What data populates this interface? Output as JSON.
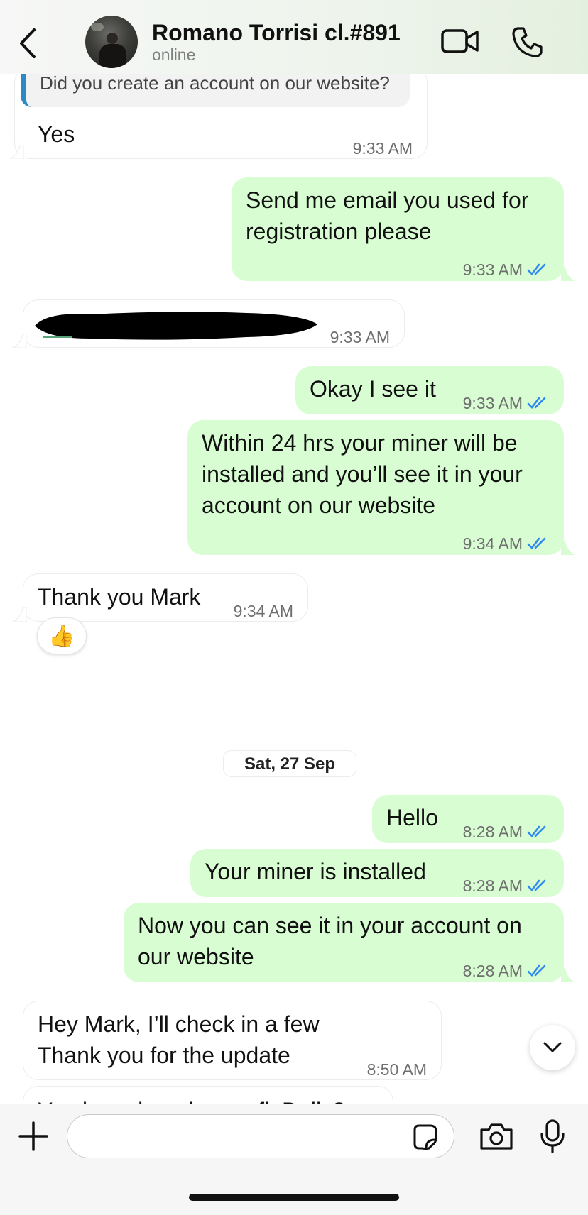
{
  "header": {
    "contact_name": "Romano Torrisi cl.#891",
    "status": "online",
    "icons": [
      "back-icon",
      "avatar",
      "video-call-icon",
      "phone-call-icon"
    ]
  },
  "messages": {
    "m1": {
      "direction": "in",
      "quoted": "Did you create an account on our website?",
      "text": "Yes",
      "time": "9:33 AM"
    },
    "m2": {
      "direction": "out",
      "lines": [
        "Send me email you used for",
        "registration please"
      ],
      "time": "9:33 AM",
      "status": "read"
    },
    "m3": {
      "direction": "in",
      "redacted": true,
      "time": "9:33 AM"
    },
    "m4": {
      "direction": "out",
      "text": "Okay I see it",
      "time": "9:33 AM",
      "status": "read"
    },
    "m5": {
      "direction": "out",
      "lines": [
        "Within 24 hrs your miner will be",
        "installed and you’ll see it in your",
        "account on our website"
      ],
      "time": "9:34 AM",
      "status": "read"
    },
    "m6": {
      "direction": "in",
      "text": "Thank you Mark",
      "time": "9:34 AM",
      "reaction": "👍"
    },
    "date_separator": "Sat, 27 Sep",
    "m7": {
      "direction": "out",
      "text": "Hello",
      "time": "8:28 AM",
      "status": "read"
    },
    "m8": {
      "direction": "out",
      "text": "Your miner is installed",
      "time": "8:28 AM",
      "status": "read"
    },
    "m9": {
      "direction": "out",
      "lines": [
        "Now you can see it in your account on",
        "our website"
      ],
      "time": "8:28 AM",
      "status": "read"
    },
    "m10": {
      "direction": "in",
      "lines": [
        "Hey Mark, I’ll check in a few",
        "Thank you for the update"
      ],
      "time": "8:50 AM"
    },
    "m11": {
      "direction": "in",
      "partial_text": "You have it under top fit Daily?"
    }
  },
  "composer": {
    "value": "",
    "icons": [
      "plus-icon",
      "sticker-icon",
      "camera-icon",
      "microphone-icon"
    ]
  },
  "colors": {
    "outgoing_bubble": "#d9fdd3",
    "incoming_bubble": "#ffffff",
    "read_ticks": "#2f8bf0",
    "quote_bar": "#2b89c6"
  }
}
